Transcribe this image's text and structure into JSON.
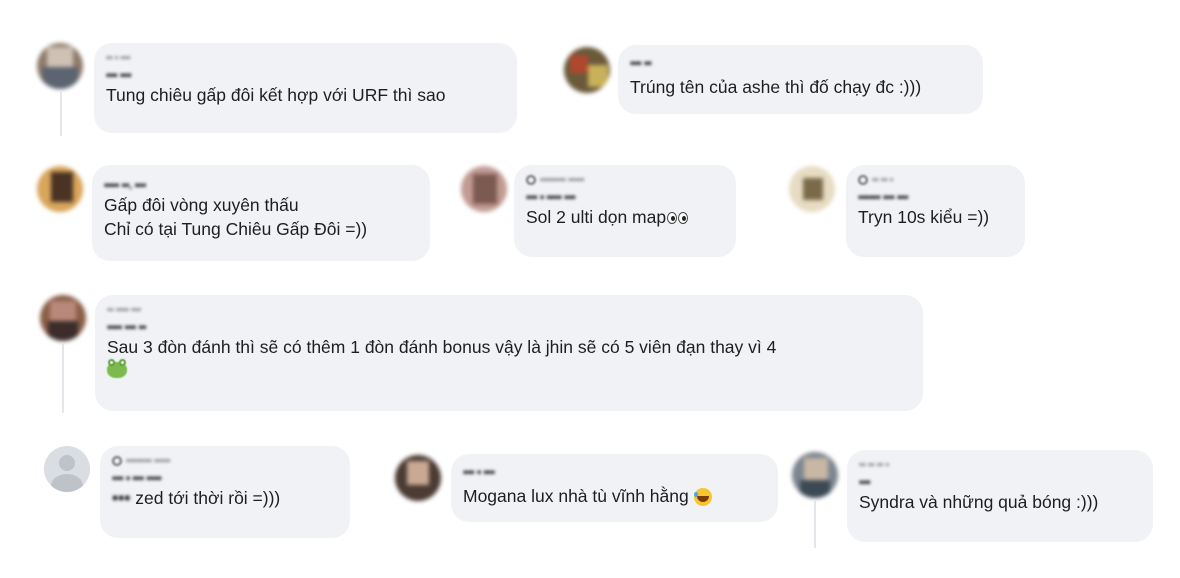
{
  "comments": [
    {
      "name": "••• •••",
      "meta": "•• • •••",
      "text": "Tung chiêu gấp đôi kết hợp với URF thì sao"
    },
    {
      "name": "••• ••",
      "text": "Trúng tên của ashe thì đố chạy đc :)))"
    },
    {
      "name": "•••• ••. •••",
      "line1": "Gấp đôi vòng xuyên thấu",
      "line2": "Chỉ có tại Tung Chiêu Gấp Đôi =))"
    },
    {
      "name": "••• • •••• •••",
      "meta": "•••••••• •••••",
      "text": "Sol 2 ulti dọn map"
    },
    {
      "name": "•••••• ••• •••",
      "meta": "•• •• •",
      "text": "Tryn 10s kiểu =))"
    },
    {
      "name": "•••• ••• ••",
      "meta": "•• •••• •••",
      "text": "Sau 3 đòn đánh thì sẽ có thêm 1 đòn đánh bonus vậy là jhin sẽ có 5 viên đạn thay vì 4"
    },
    {
      "name": "••• • ••• ••••",
      "meta": "•••••••• •••••",
      "mention": "•••",
      "text": "zed tới thời rồi =)))"
    },
    {
      "name": "••• • •••",
      "text": "Mogana lux nhà tù vĩnh hằng"
    },
    {
      "name": "•••",
      "meta": "•• •• •• •",
      "text": "Syndra và những quả bóng :)))"
    }
  ],
  "colors": {
    "bubble": "#f0f2f5",
    "text": "#1c1e21",
    "muted": "#65676b"
  },
  "icons": [
    "eyes-emoji-icon",
    "laughing-emoji-icon",
    "frog-emoji-icon",
    "badge-icon",
    "default-avatar-icon"
  ]
}
